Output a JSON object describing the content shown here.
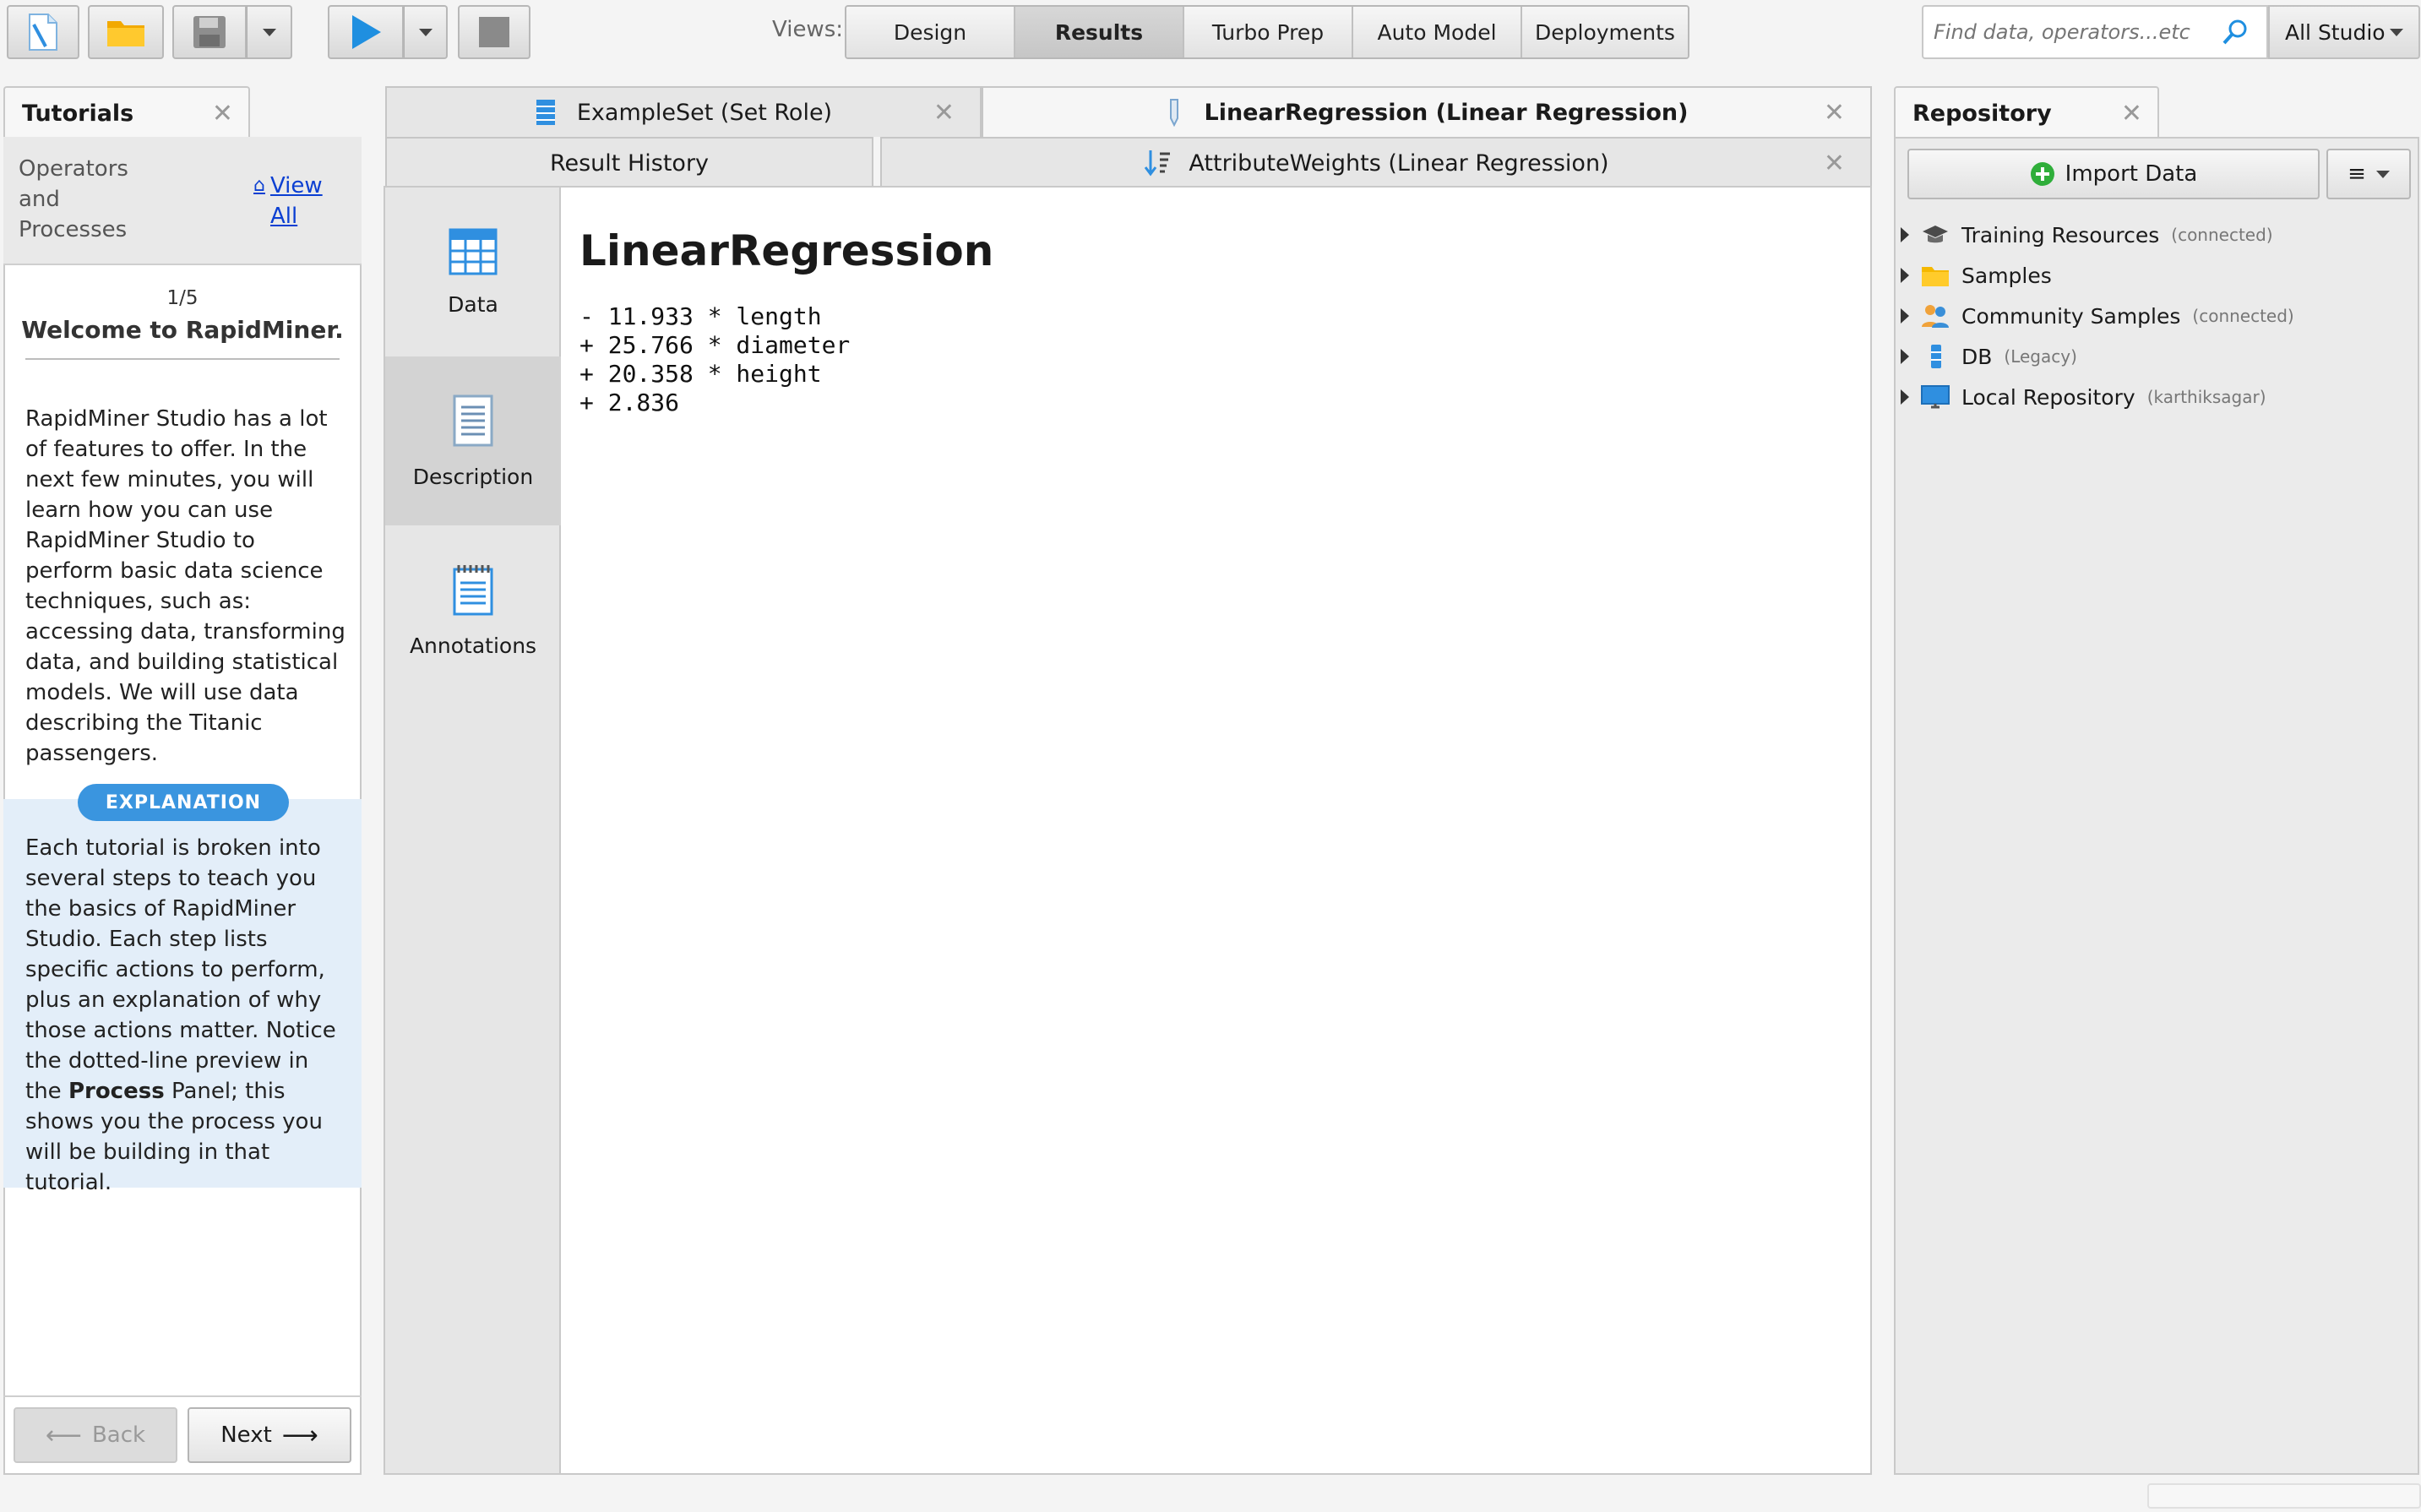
{
  "toolbar": {
    "views_label": "Views:",
    "views": [
      {
        "label": "Design",
        "active": false
      },
      {
        "label": "Results",
        "active": true
      },
      {
        "label": "Turbo Prep",
        "active": false
      },
      {
        "label": "Auto Model",
        "active": false
      },
      {
        "label": "Deployments",
        "active": false
      }
    ],
    "search_placeholder": "Find data, operators...etc",
    "search_scope": "All Studio"
  },
  "tutorials": {
    "tab_title": "Tutorials",
    "header_label": "Operators and Processes",
    "view_all": "View All",
    "step": "1/5",
    "step_title": "Welcome to RapidMiner.",
    "intro": "RapidMiner Studio has a lot of features to offer. In the next few minutes, you will learn how you can use RapidMiner Studio to perform basic data science techniques, such as: accessing data, transforming data, and building statistical models. We will use data describing the Titanic passengers.",
    "explanation_badge": "EXPLANATION",
    "explanation_part1": "Each tutorial is broken into several steps to teach you the basics of RapidMiner Studio. Each step lists specific actions to perform, plus an explanation of why those actions matter. Notice the dotted-line preview in the ",
    "explanation_bold": "Process",
    "explanation_part2": " Panel; this shows you the process you will be building in that tutorial.",
    "back_label": "Back",
    "next_label": "Next"
  },
  "results": {
    "tabs_row1": [
      {
        "label": "ExampleSet (Set Role)",
        "icon": "exampleset-icon",
        "active": false
      },
      {
        "label": "LinearRegression (Linear Regression)",
        "icon": "model-icon",
        "active": true
      }
    ],
    "tabs_row2": [
      {
        "label": "Result History",
        "icon": "",
        "active": false
      },
      {
        "label": "AttributeWeights (Linear Regression)",
        "icon": "weights-icon",
        "active": false
      }
    ],
    "side_nav": [
      {
        "label": "Data",
        "icon": "table-icon",
        "active": false
      },
      {
        "label": "Description",
        "icon": "document-icon",
        "active": true
      },
      {
        "label": "Annotations",
        "icon": "notepad-icon",
        "active": false
      }
    ],
    "model_title": "LinearRegression",
    "equation": [
      "- 11.933 * length",
      "+ 25.766 * diameter",
      "+ 20.358 * height",
      "+ 2.836"
    ]
  },
  "repository": {
    "tab_title": "Repository",
    "import_label": "Import Data",
    "menu_label": "≡",
    "items": [
      {
        "label": "Training Resources",
        "note": "(connected)",
        "icon": "graduation-cap-icon"
      },
      {
        "label": "Samples",
        "note": "",
        "icon": "folder-icon"
      },
      {
        "label": "Community Samples",
        "note": "(connected)",
        "icon": "people-icon"
      },
      {
        "label": "DB",
        "note": "(Legacy)",
        "icon": "database-icon"
      },
      {
        "label": "Local Repository",
        "note": "(karthiksagar)",
        "icon": "monitor-icon"
      }
    ]
  },
  "colors": {
    "accent": "#3a95df",
    "link": "#0b3fd2",
    "explanation_bg": "#e3eef9",
    "run_icon": "#1f8fe0",
    "folder": "#f5b800",
    "import_plus": "#2fae3a"
  }
}
